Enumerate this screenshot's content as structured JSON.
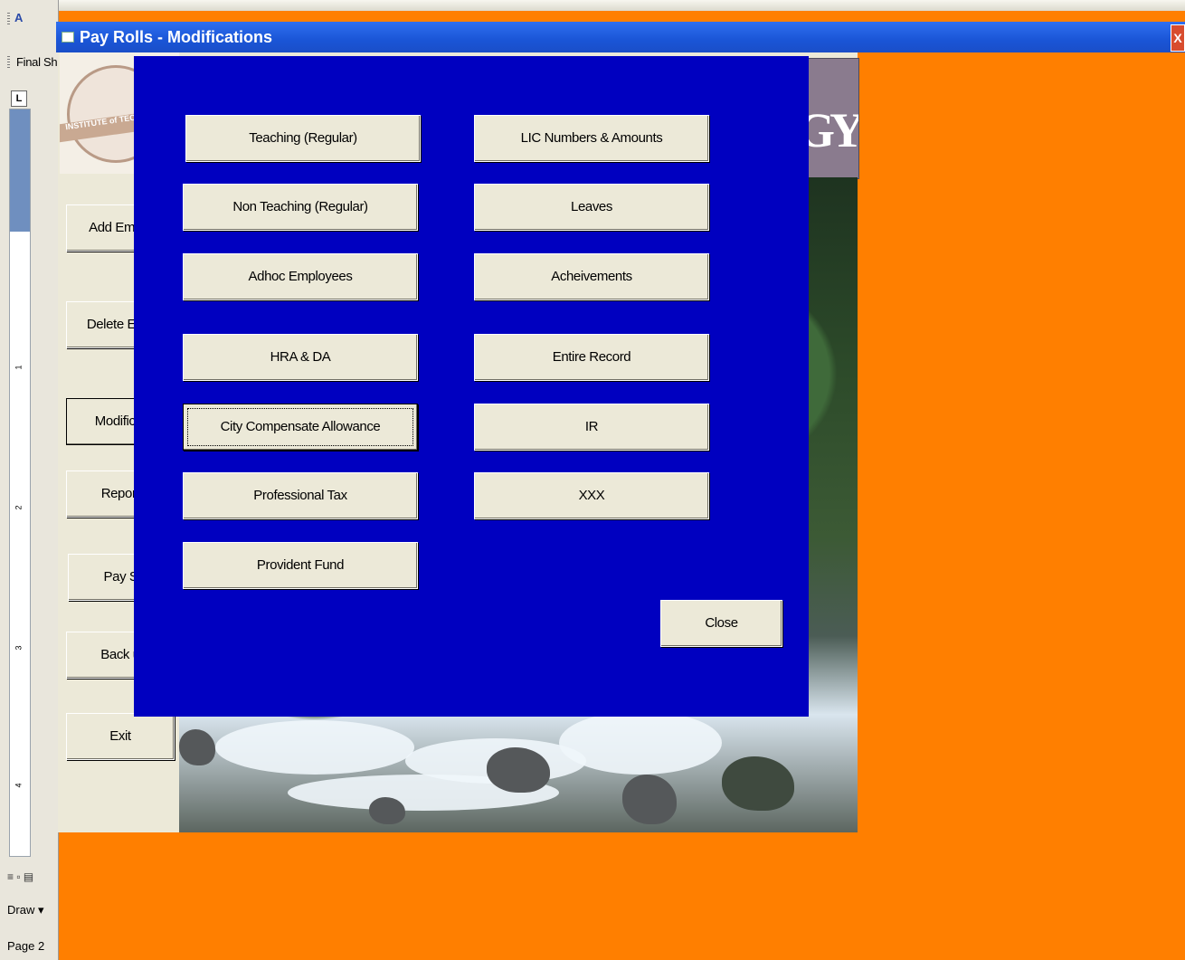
{
  "word": {
    "toolbar_label": "Final Sh",
    "font_icon_label": "A",
    "draw_label": "Draw ▾",
    "page_label": "Page  2",
    "ruler_numbers": [
      "1",
      "2",
      "3",
      "4"
    ],
    "ruler_corner": "L"
  },
  "window": {
    "title": "Pay Rolls - Modifications",
    "close_glyph": "X"
  },
  "banner": {
    "text": "GY"
  },
  "logo": {
    "seal_text": "INSTITUTE of TEC"
  },
  "sidebar": {
    "items": [
      {
        "label": "Add Emplo"
      },
      {
        "label": "Delete Emp"
      },
      {
        "label": "Modificat"
      },
      {
        "label": "Report"
      },
      {
        "label": "Pay Sl"
      },
      {
        "label": "Back u"
      },
      {
        "label": "Exit"
      }
    ]
  },
  "dialog": {
    "left_buttons": [
      {
        "label": "Teaching (Regular)"
      },
      {
        "label": "Non Teaching (Regular)"
      },
      {
        "label": "Adhoc Employees"
      },
      {
        "label": "HRA & DA"
      },
      {
        "label": "City Compensate Allowance"
      },
      {
        "label": "Professional Tax"
      },
      {
        "label": "Provident Fund"
      }
    ],
    "right_buttons": [
      {
        "label": "LIC Numbers & Amounts"
      },
      {
        "label": "Leaves"
      },
      {
        "label": "Acheivements"
      },
      {
        "label": "Entire Record"
      },
      {
        "label": "IR"
      },
      {
        "label": "XXX"
      }
    ],
    "close_label": "Close"
  },
  "colors": {
    "dialog_bg": "#0000c0",
    "desktop_bg": "#ff7f00",
    "title_bar": "#1a55d6",
    "button_face": "#ece9d8"
  }
}
